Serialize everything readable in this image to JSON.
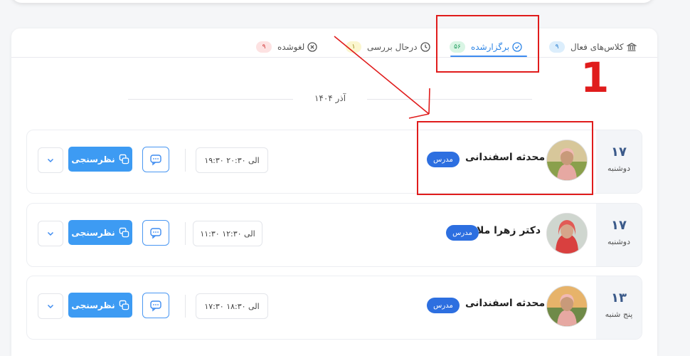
{
  "tabs": [
    {
      "label": "کلاس‌های فعال",
      "count": "۹",
      "icon": "building-icon",
      "badge_bg": "#dceefc",
      "badge_color": "#2b7fd0"
    },
    {
      "label": "برگزارشده",
      "count": "۵۶",
      "icon": "check-circle-icon",
      "badge_bg": "#d9f5e4",
      "badge_color": "#1c9a5a",
      "active": true
    },
    {
      "label": "درحال بررسی",
      "count": "۱",
      "icon": "clock-icon",
      "badge_bg": "#fbf6cf",
      "badge_color": "#9a8a16"
    },
    {
      "label": "لغوشده",
      "count": "۹",
      "icon": "x-circle-icon",
      "badge_bg": "#fde2e2",
      "badge_color": "#d23c3c"
    }
  ],
  "month_label": "آذر ۱۴۰۴",
  "sessions": [
    {
      "day_num": "۱۷",
      "day_name": "دوشنبه",
      "teacher": "محدثه اسفندانی",
      "role": "مدرس",
      "time": "۱۹:۳۰ الی ۲۰:۳۰",
      "survey_label": "نظرسنجی"
    },
    {
      "day_num": "۱۷",
      "day_name": "دوشنبه",
      "teacher": "دکتر زهرا ملا",
      "role": "مدرس",
      "time": "۱۱:۳۰ الی ۱۲:۳۰",
      "survey_label": "نظرسنجی"
    },
    {
      "day_num": "۱۳",
      "day_name": "پنج شنبه",
      "teacher": "محدثه اسفندانی",
      "role": "مدرس",
      "time": "۱۷:۳۰ الی ۱۸:۳۰",
      "survey_label": "نظرسنجی"
    }
  ],
  "annotation": {
    "number": "1",
    "color": "#e01c1c"
  },
  "colors": {
    "accent": "#3d9bf3",
    "role_badge": "#2d6fe0"
  }
}
